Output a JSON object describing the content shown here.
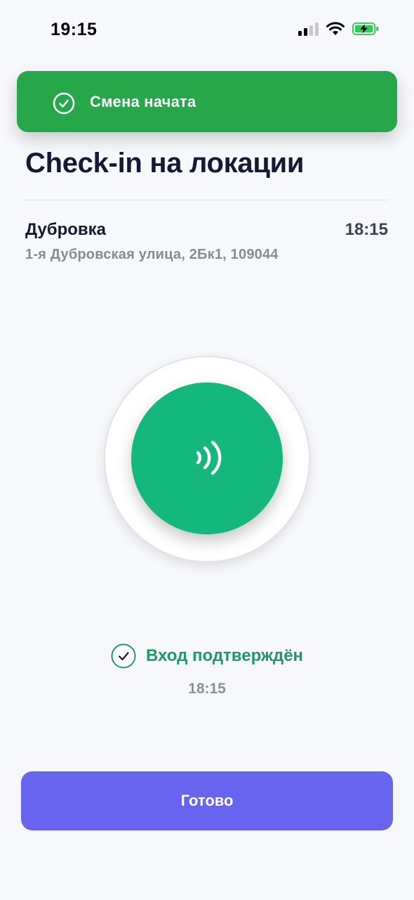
{
  "status_bar": {
    "time": "19:15",
    "icons": [
      "signal-icon",
      "wifi-icon",
      "battery-charging-icon"
    ]
  },
  "toast": {
    "icon": "check-circle-icon",
    "text": "Смена начата",
    "color": "#27a74a"
  },
  "page": {
    "title": "Check-in на локации"
  },
  "location": {
    "name": "Дубровка",
    "time": "18:15",
    "address": "1-я Дубровская улица, 2Бк1, 109044"
  },
  "nfc": {
    "icon": "nfc-waves-icon",
    "color": "#14b87c"
  },
  "confirmation": {
    "icon": "check-circle-icon",
    "text": "Вход подтверждён",
    "time": "18:15",
    "color": "#1f9a66"
  },
  "actions": {
    "done_label": "Готово",
    "color": "#6765f0"
  }
}
